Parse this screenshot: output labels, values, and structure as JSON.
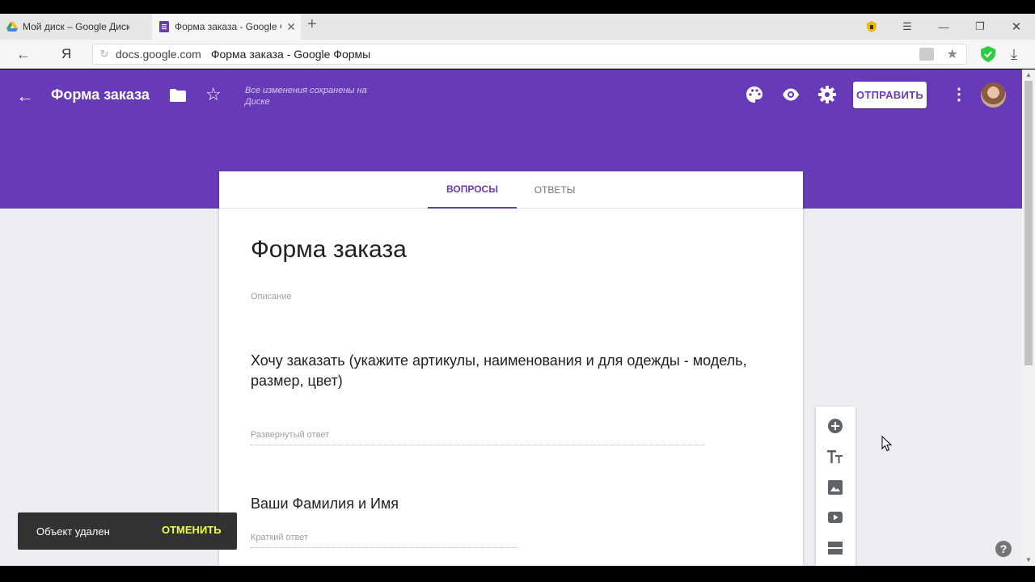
{
  "browser": {
    "tabs": [
      {
        "label": "Мой диск – Google Диск",
        "icon": "google-drive-icon"
      },
      {
        "label": "Форма заказа - Google Ф",
        "icon": "google-forms-icon"
      }
    ],
    "new_tab": "+",
    "address": {
      "domain": "docs.google.com",
      "page_title": "Форма заказа - Google Формы"
    },
    "yandex_logo": "Я"
  },
  "header": {
    "title": "Форма заказа",
    "saved_status": "Все изменения сохранены на Диске",
    "send_label": "ОТПРАВИТЬ",
    "color": "#673ab7"
  },
  "tabs": {
    "questions": "ВОПРОСЫ",
    "responses": "ОТВЕТЫ"
  },
  "form": {
    "title": "Форма заказа",
    "description_placeholder": "Описание",
    "questions": [
      {
        "title": "Хочу заказать (укажите артикулы, наименования и для одежды - модель, размер, цвет)",
        "answer_placeholder": "Развернутый ответ"
      },
      {
        "title": "Ваши Фамилия и Имя",
        "answer_placeholder": "Краткий ответ"
      }
    ]
  },
  "sidebar": {
    "items": [
      "add-question-icon",
      "add-title-icon",
      "add-image-icon",
      "add-video-icon",
      "add-section-icon"
    ]
  },
  "snackbar": {
    "message": "Объект удален",
    "action": "ОТМЕНИТЬ"
  },
  "help": "?"
}
